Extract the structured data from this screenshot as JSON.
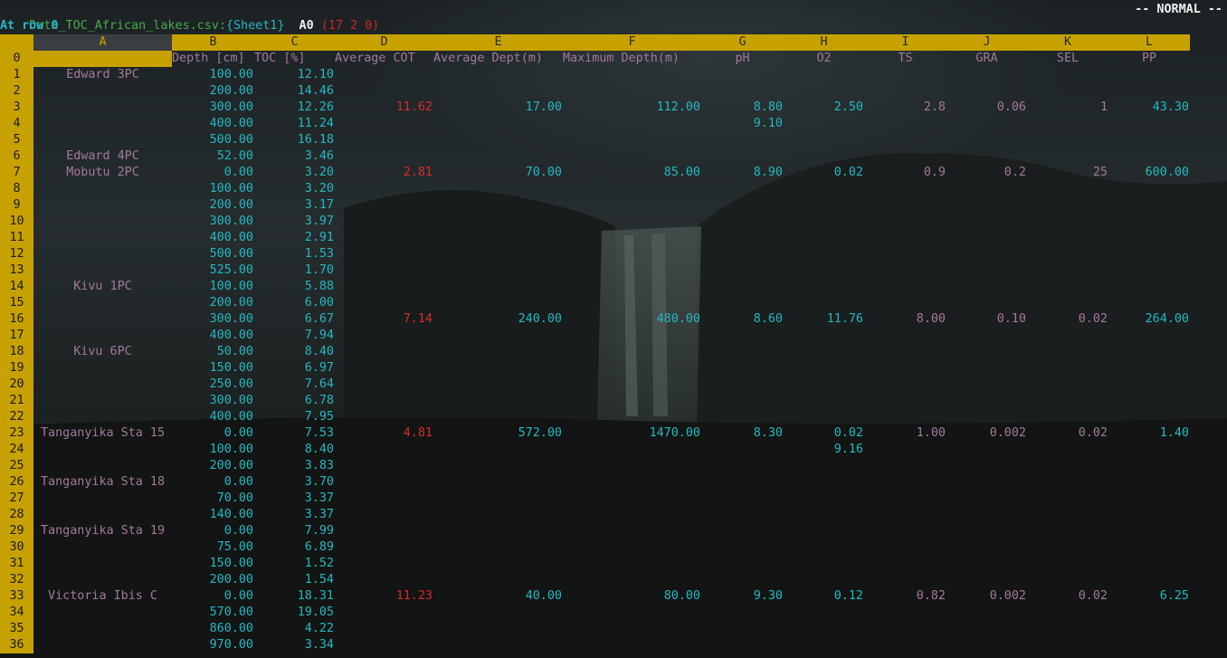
{
  "status": {
    "filename": "Data_TOC_African_lakes.csv:",
    "sheet": "{Sheet1}",
    "cell_ref": "A0",
    "coords": "(17 2 0)",
    "mode": "-- NORMAL --",
    "message": "At row 0"
  },
  "columns": [
    "A",
    "B",
    "C",
    "D",
    "E",
    "F",
    "G",
    "H",
    "I",
    "J",
    "K",
    "L"
  ],
  "header_row": {
    "num": "0",
    "cells": [
      "",
      "Depth [cm]",
      "TOC [%]",
      "Average COT",
      "Average Dept(m)",
      "Maximum Depth(m)",
      "pH",
      "O2",
      "TS",
      "GRA",
      "SEL",
      "PP"
    ]
  },
  "rows": [
    {
      "num": "1",
      "a": "Edward 3PC",
      "b": "100.00",
      "c": "12.10",
      "d": "",
      "e": "",
      "f": "",
      "g": "",
      "h": "",
      "i": "",
      "j": "",
      "k": "",
      "l": ""
    },
    {
      "num": "2",
      "a": "",
      "b": "200.00",
      "c": "14.46",
      "d": "",
      "e": "",
      "f": "",
      "g": "",
      "h": "",
      "i": "",
      "j": "",
      "k": "",
      "l": ""
    },
    {
      "num": "3",
      "a": "",
      "b": "300.00",
      "c": "12.26",
      "d": "11.62",
      "e": "17.00",
      "f": "112.00",
      "g": "8.80",
      "h": "2.50",
      "i": "2.8",
      "j": "0.06",
      "k": "1",
      "l": "43.30"
    },
    {
      "num": "4",
      "a": "",
      "b": "400.00",
      "c": "11.24",
      "d": "",
      "e": "",
      "f": "",
      "g": "9.10",
      "h": "",
      "i": "",
      "j": "",
      "k": "",
      "l": ""
    },
    {
      "num": "5",
      "a": "",
      "b": "500.00",
      "c": "16.18",
      "d": "",
      "e": "",
      "f": "",
      "g": "",
      "h": "",
      "i": "",
      "j": "",
      "k": "",
      "l": ""
    },
    {
      "num": "6",
      "a": "Edward 4PC",
      "b": "52.00",
      "c": "3.46",
      "d": "",
      "e": "",
      "f": "",
      "g": "",
      "h": "",
      "i": "",
      "j": "",
      "k": "",
      "l": ""
    },
    {
      "num": "7",
      "a": "Mobutu 2PC",
      "b": "0.00",
      "c": "3.20",
      "d": "2.81",
      "e": "70.00",
      "f": "85.00",
      "g": "8.90",
      "h": "0.02",
      "i": "0.9",
      "j": "0.2",
      "k": "25",
      "l": "600.00"
    },
    {
      "num": "8",
      "a": "",
      "b": "100.00",
      "c": "3.20",
      "d": "",
      "e": "",
      "f": "",
      "g": "",
      "h": "",
      "i": "",
      "j": "",
      "k": "",
      "l": ""
    },
    {
      "num": "9",
      "a": "",
      "b": "200.00",
      "c": "3.17",
      "d": "",
      "e": "",
      "f": "",
      "g": "",
      "h": "",
      "i": "",
      "j": "",
      "k": "",
      "l": ""
    },
    {
      "num": "10",
      "a": "",
      "b": "300.00",
      "c": "3.97",
      "d": "",
      "e": "",
      "f": "",
      "g": "",
      "h": "",
      "i": "",
      "j": "",
      "k": "",
      "l": ""
    },
    {
      "num": "11",
      "a": "",
      "b": "400.00",
      "c": "2.91",
      "d": "",
      "e": "",
      "f": "",
      "g": "",
      "h": "",
      "i": "",
      "j": "",
      "k": "",
      "l": ""
    },
    {
      "num": "12",
      "a": "",
      "b": "500.00",
      "c": "1.53",
      "d": "",
      "e": "",
      "f": "",
      "g": "",
      "h": "",
      "i": "",
      "j": "",
      "k": "",
      "l": ""
    },
    {
      "num": "13",
      "a": "",
      "b": "525.00",
      "c": "1.70",
      "d": "",
      "e": "",
      "f": "",
      "g": "",
      "h": "",
      "i": "",
      "j": "",
      "k": "",
      "l": ""
    },
    {
      "num": "14",
      "a": "Kivu 1PC",
      "b": "100.00",
      "c": "5.88",
      "d": "",
      "e": "",
      "f": "",
      "g": "",
      "h": "",
      "i": "",
      "j": "",
      "k": "",
      "l": ""
    },
    {
      "num": "15",
      "a": "",
      "b": "200.00",
      "c": "6.00",
      "d": "",
      "e": "",
      "f": "",
      "g": "",
      "h": "",
      "i": "",
      "j": "",
      "k": "",
      "l": ""
    },
    {
      "num": "16",
      "a": "",
      "b": "300.00",
      "c": "6.67",
      "d": "7.14",
      "e": "240.00",
      "f": "480.00",
      "g": "8.60",
      "h": "11.76",
      "i": "8.00",
      "j": "0.10",
      "k": "0.02",
      "l": "264.00"
    },
    {
      "num": "17",
      "a": "",
      "b": "400.00",
      "c": "7.94",
      "d": "",
      "e": "",
      "f": "",
      "g": "",
      "h": "",
      "i": "",
      "j": "",
      "k": "",
      "l": ""
    },
    {
      "num": "18",
      "a": "Kivu 6PC",
      "b": "50.00",
      "c": "8.40",
      "d": "",
      "e": "",
      "f": "",
      "g": "",
      "h": "",
      "i": "",
      "j": "",
      "k": "",
      "l": ""
    },
    {
      "num": "19",
      "a": "",
      "b": "150.00",
      "c": "6.97",
      "d": "",
      "e": "",
      "f": "",
      "g": "",
      "h": "",
      "i": "",
      "j": "",
      "k": "",
      "l": ""
    },
    {
      "num": "20",
      "a": "",
      "b": "250.00",
      "c": "7.64",
      "d": "",
      "e": "",
      "f": "",
      "g": "",
      "h": "",
      "i": "",
      "j": "",
      "k": "",
      "l": ""
    },
    {
      "num": "21",
      "a": "",
      "b": "300.00",
      "c": "6.78",
      "d": "",
      "e": "",
      "f": "",
      "g": "",
      "h": "",
      "i": "",
      "j": "",
      "k": "",
      "l": ""
    },
    {
      "num": "22",
      "a": "",
      "b": "400.00",
      "c": "7.95",
      "d": "",
      "e": "",
      "f": "",
      "g": "",
      "h": "",
      "i": "",
      "j": "",
      "k": "",
      "l": ""
    },
    {
      "num": "23",
      "a": "Tanganyika Sta 15",
      "b": "0.00",
      "c": "7.53",
      "d": "4.81",
      "e": "572.00",
      "f": "1470.00",
      "g": "8.30",
      "h": "0.02",
      "i": "1.00",
      "j": "0.002",
      "k": "0.02",
      "l": "1.40"
    },
    {
      "num": "24",
      "a": "",
      "b": "100.00",
      "c": "8.40",
      "d": "",
      "e": "",
      "f": "",
      "g": "",
      "h": "9.16",
      "i": "",
      "j": "",
      "k": "",
      "l": ""
    },
    {
      "num": "25",
      "a": "",
      "b": "200.00",
      "c": "3.83",
      "d": "",
      "e": "",
      "f": "",
      "g": "",
      "h": "",
      "i": "",
      "j": "",
      "k": "",
      "l": ""
    },
    {
      "num": "26",
      "a": "Tanganyika Sta 18",
      "b": "0.00",
      "c": "3.70",
      "d": "",
      "e": "",
      "f": "",
      "g": "",
      "h": "",
      "i": "",
      "j": "",
      "k": "",
      "l": ""
    },
    {
      "num": "27",
      "a": "",
      "b": "70.00",
      "c": "3.37",
      "d": "",
      "e": "",
      "f": "",
      "g": "",
      "h": "",
      "i": "",
      "j": "",
      "k": "",
      "l": ""
    },
    {
      "num": "28",
      "a": "",
      "b": "140.00",
      "c": "3.37",
      "d": "",
      "e": "",
      "f": "",
      "g": "",
      "h": "",
      "i": "",
      "j": "",
      "k": "",
      "l": ""
    },
    {
      "num": "29",
      "a": "Tanganyika Sta 19",
      "b": "0.00",
      "c": "7.99",
      "d": "",
      "e": "",
      "f": "",
      "g": "",
      "h": "",
      "i": "",
      "j": "",
      "k": "",
      "l": ""
    },
    {
      "num": "30",
      "a": "",
      "b": "75.00",
      "c": "6.89",
      "d": "",
      "e": "",
      "f": "",
      "g": "",
      "h": "",
      "i": "",
      "j": "",
      "k": "",
      "l": ""
    },
    {
      "num": "31",
      "a": "",
      "b": "150.00",
      "c": "1.52",
      "d": "",
      "e": "",
      "f": "",
      "g": "",
      "h": "",
      "i": "",
      "j": "",
      "k": "",
      "l": ""
    },
    {
      "num": "32",
      "a": "",
      "b": "200.00",
      "c": "1.54",
      "d": "",
      "e": "",
      "f": "",
      "g": "",
      "h": "",
      "i": "",
      "j": "",
      "k": "",
      "l": ""
    },
    {
      "num": "33",
      "a": "Victoria Ibis C",
      "b": "0.00",
      "c": "18.31",
      "d": "11.23",
      "e": "40.00",
      "f": "80.00",
      "g": "9.30",
      "h": "0.12",
      "i": "0.82",
      "j": "0.002",
      "k": "0.02",
      "l": "6.25"
    },
    {
      "num": "34",
      "a": "",
      "b": "570.00",
      "c": "19.05",
      "d": "",
      "e": "",
      "f": "",
      "g": "",
      "h": "",
      "i": "",
      "j": "",
      "k": "",
      "l": ""
    },
    {
      "num": "35",
      "a": "",
      "b": "860.00",
      "c": "4.22",
      "d": "",
      "e": "",
      "f": "",
      "g": "",
      "h": "",
      "i": "",
      "j": "",
      "k": "",
      "l": ""
    },
    {
      "num": "36",
      "a": "",
      "b": "970.00",
      "c": "3.34",
      "d": "",
      "e": "",
      "f": "",
      "g": "",
      "h": "",
      "i": "",
      "j": "",
      "k": "",
      "l": ""
    }
  ]
}
